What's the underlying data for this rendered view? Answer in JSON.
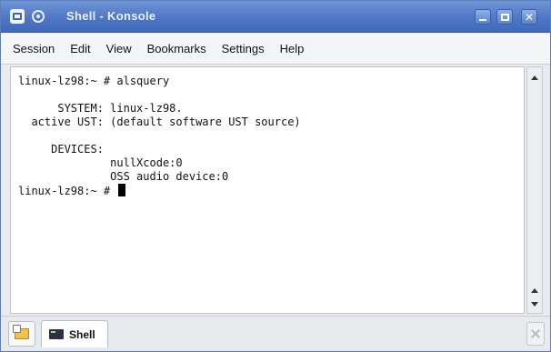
{
  "window": {
    "title": "Shell - Konsole",
    "titlebar_color": "#4f77c4"
  },
  "icons": {
    "window_menu": "window-menu-icon",
    "pin": "pin-icon",
    "minimize": "minimize-icon",
    "maximize": "maximize-icon",
    "close": "close-icon",
    "new_tab": "new-tab-icon",
    "terminal_tab": "terminal-icon",
    "close_tab": "close-tab-icon"
  },
  "menubar": {
    "items": [
      "Session",
      "Edit",
      "View",
      "Bookmarks",
      "Settings",
      "Help"
    ]
  },
  "terminal": {
    "lines": [
      "linux-lz98:~ # alsquery",
      "",
      "      SYSTEM: linux-lz98.",
      "  active UST: (default software UST source)",
      "",
      "     DEVICES:",
      "              nullXcode:0",
      "              OSS audio device:0"
    ],
    "prompt": "linux-lz98:~ # "
  },
  "tabs": [
    {
      "label": "Shell",
      "active": true
    }
  ]
}
